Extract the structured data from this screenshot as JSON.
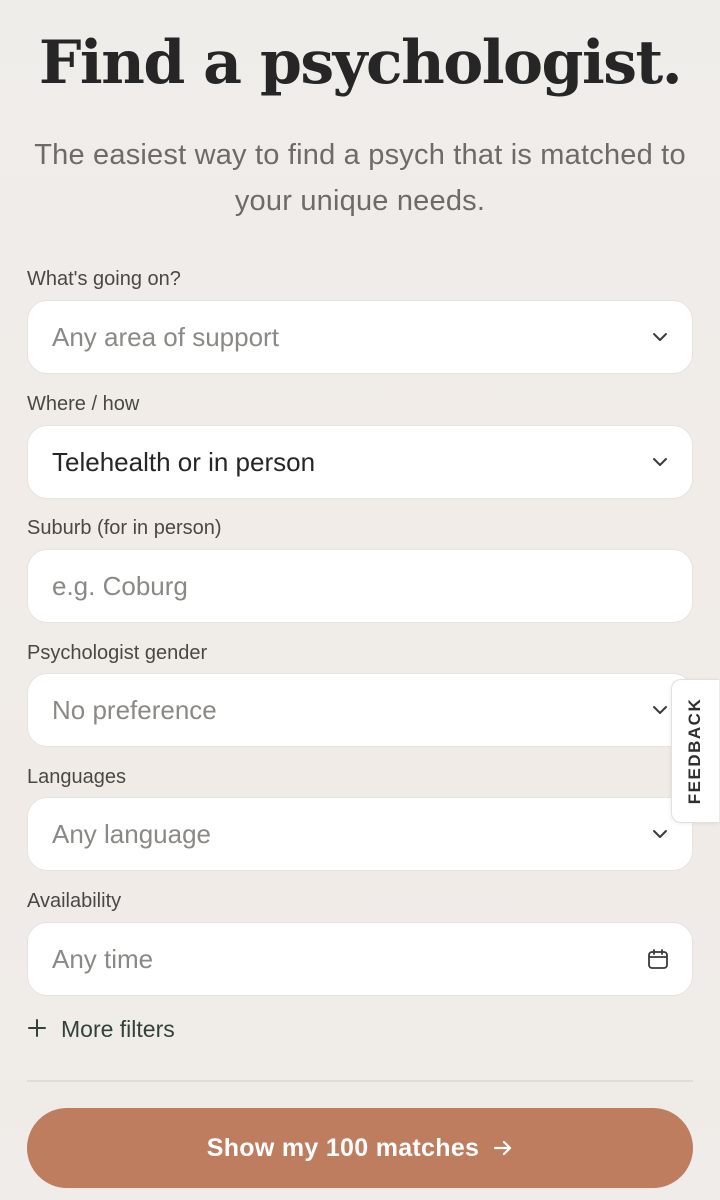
{
  "header": {
    "title": "Find a psychologist.",
    "subtitle": "The easiest way to find a psych that is matched to your unique needs."
  },
  "form": {
    "support": {
      "label": "What's going on?",
      "value": "Any area of support",
      "icon": "chevron-down-icon"
    },
    "mode": {
      "label": "Where / how",
      "value": "Telehealth or in person",
      "icon": "chevron-down-icon"
    },
    "suburb": {
      "label": "Suburb (for in person)",
      "placeholder": "e.g. Coburg"
    },
    "gender": {
      "label": "Psychologist gender",
      "value": "No preference",
      "icon": "chevron-down-icon"
    },
    "languages": {
      "label": "Languages",
      "value": "Any language",
      "icon": "chevron-down-icon"
    },
    "availability": {
      "label": "Availability",
      "value": "Any time",
      "icon": "calendar-icon"
    },
    "more_filters": {
      "icon": "plus-icon",
      "label": "More filters"
    }
  },
  "cta": {
    "label": "Show my 100 matches",
    "icon": "arrow-right-icon"
  },
  "feedback_tab": {
    "label": "FEEDBACK"
  },
  "colors": {
    "accent": "#bd7d5e",
    "text_dark": "#262626",
    "placeholder": "#8b8986",
    "link": "#334239"
  }
}
